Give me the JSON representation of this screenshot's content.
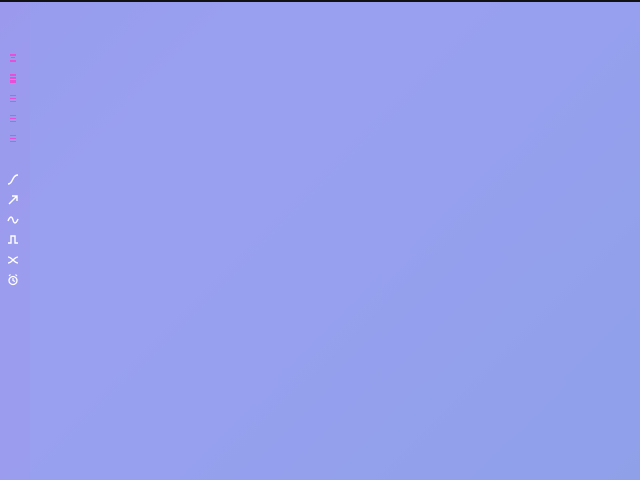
{
  "colors": {
    "background": "#979ced",
    "tool_pink": "#e64fd8",
    "tool_white": "#ffffff",
    "top_strip": "#111111"
  },
  "toolbar": {
    "tools": [
      {
        "icon": "bar-level-1-icon",
        "state": "pink"
      },
      {
        "icon": "bar-level-2-icon",
        "state": "pink"
      },
      {
        "icon": "bar-level-3-icon",
        "state": "pink"
      },
      {
        "icon": "bar-level-4-icon",
        "state": "pink"
      },
      {
        "icon": "bar-level-5-icon",
        "state": "pink"
      },
      {
        "icon": "curve-icon",
        "state": "white"
      },
      {
        "icon": "arrow-up-right-icon",
        "state": "white"
      },
      {
        "icon": "sine-wave-icon",
        "state": "white"
      },
      {
        "icon": "square-wave-icon",
        "state": "white"
      },
      {
        "icon": "shuffle-icon",
        "state": "white"
      },
      {
        "icon": "alarm-clock-icon",
        "state": "white"
      }
    ]
  }
}
